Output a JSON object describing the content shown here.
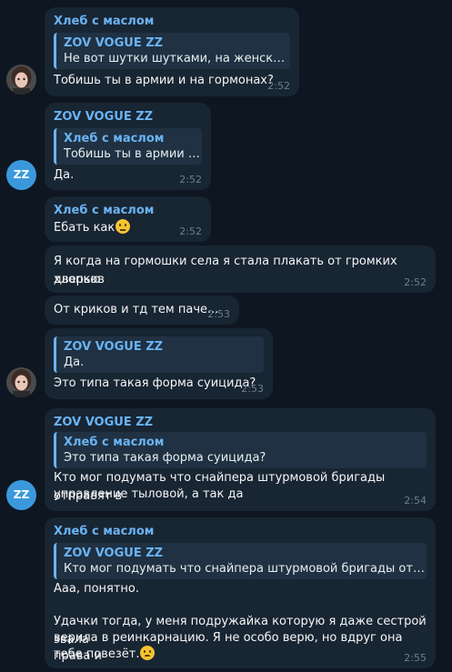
{
  "messages": [
    {
      "sender": "Хлеб с маслом",
      "reply_name": "ZOV VOGUE ZZ",
      "reply_text": "Не вот шутки шутками, на женских г...",
      "text": "Тобишь ты в армии и на гормонах?",
      "time": "2:52"
    },
    {
      "sender": "ZOV VOGUE ZZ",
      "reply_name": "Хлеб с маслом",
      "reply_text": "Тобишь ты в армии и...",
      "text": "Да.",
      "time": "2:52"
    },
    {
      "sender": "Хлеб с маслом",
      "text": "Ебать как",
      "emoji": "neutral-face-emoji",
      "time": "2:52"
    },
    {
      "text_line1": "Я когда на гормошки села я стала плакать от громких хлопков",
      "text_line2": "дверью",
      "time": "2:52"
    },
    {
      "text": "От криков и тд тем паче...",
      "time": "2:53"
    },
    {
      "reply_name": "ZOV VOGUE ZZ",
      "reply_text": "Да.",
      "text": "Это типа такая форма суицида?",
      "time": "2:53"
    },
    {
      "sender": "ZOV VOGUE ZZ",
      "reply_name": "Хлеб с маслом",
      "reply_text": "Это типа такая форма суицида?",
      "text_line1": "Кто мог подумать что снайпера штурмовой бригады отправят в",
      "text_line2": "управление тыловой, а так да",
      "time": "2:54"
    },
    {
      "sender": "Хлеб с маслом",
      "reply_name": "ZOV VOGUE ZZ",
      "reply_text": "Кто мог подумать что снайпера штурмовой бригады отправ...",
      "text_line1": "Ааа, понятно.",
      "text_line2": "Удачки тогда, у меня подружайка которую я даже сестрой звала",
      "text_line3": "верила в реинкарнацию. Я не особо верю, но вдруг она права и",
      "text_line4": "тебе повезёт.",
      "emoji": "pensive-face-emoji",
      "time": "2:55"
    }
  ],
  "avatars": {
    "zz_initials": "ZZ",
    "accent": "#3a99dc"
  },
  "colors": {
    "background": "#0e1621",
    "bubble": "#182533",
    "name": "#6ab3f3",
    "quote_bar": "#6ab3f3",
    "time": "#6d7f8f"
  }
}
